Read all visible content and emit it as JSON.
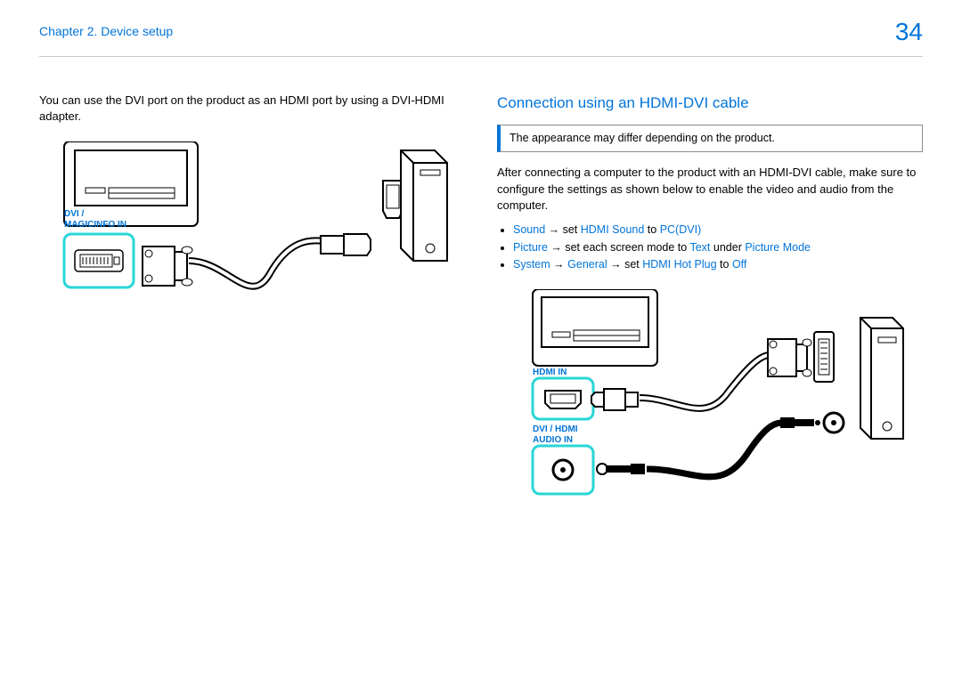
{
  "header": {
    "chapter": "Chapter 2. Device setup",
    "page": "34"
  },
  "left": {
    "intro": "You can use the DVI port on the product as an HDMI port by using a DVI-HDMI adapter.",
    "portLabel1": "DVI /",
    "portLabel2": "MAGICINFO IN"
  },
  "right": {
    "title": "Connection using an HDMI-DVI cable",
    "note": "The appearance may differ depending on the product.",
    "body": "After connecting a computer to the product with an HDMI-DVI cable, make sure to configure the settings as shown below to enable the video and audio from the computer.",
    "bullets": {
      "b1": {
        "a": "Sound",
        "arrow": " →  set ",
        "b": "HDMI Sound",
        "to": " to ",
        "c": "PC(DVI)"
      },
      "b2": {
        "a": "Picture",
        "arrow": " → set each screen mode to ",
        "b": "Text",
        "under": " under ",
        "c": "Picture Mode"
      },
      "b3": {
        "a": "System",
        "arr1": " → ",
        "b": "General",
        "arr2": " → set ",
        "c": "HDMI Hot Plug",
        "to": " to ",
        "d": "Off"
      }
    },
    "portLabel1": "HDMI IN",
    "portLabel2a": "DVI / HDMI",
    "portLabel2b": "AUDIO IN"
  }
}
